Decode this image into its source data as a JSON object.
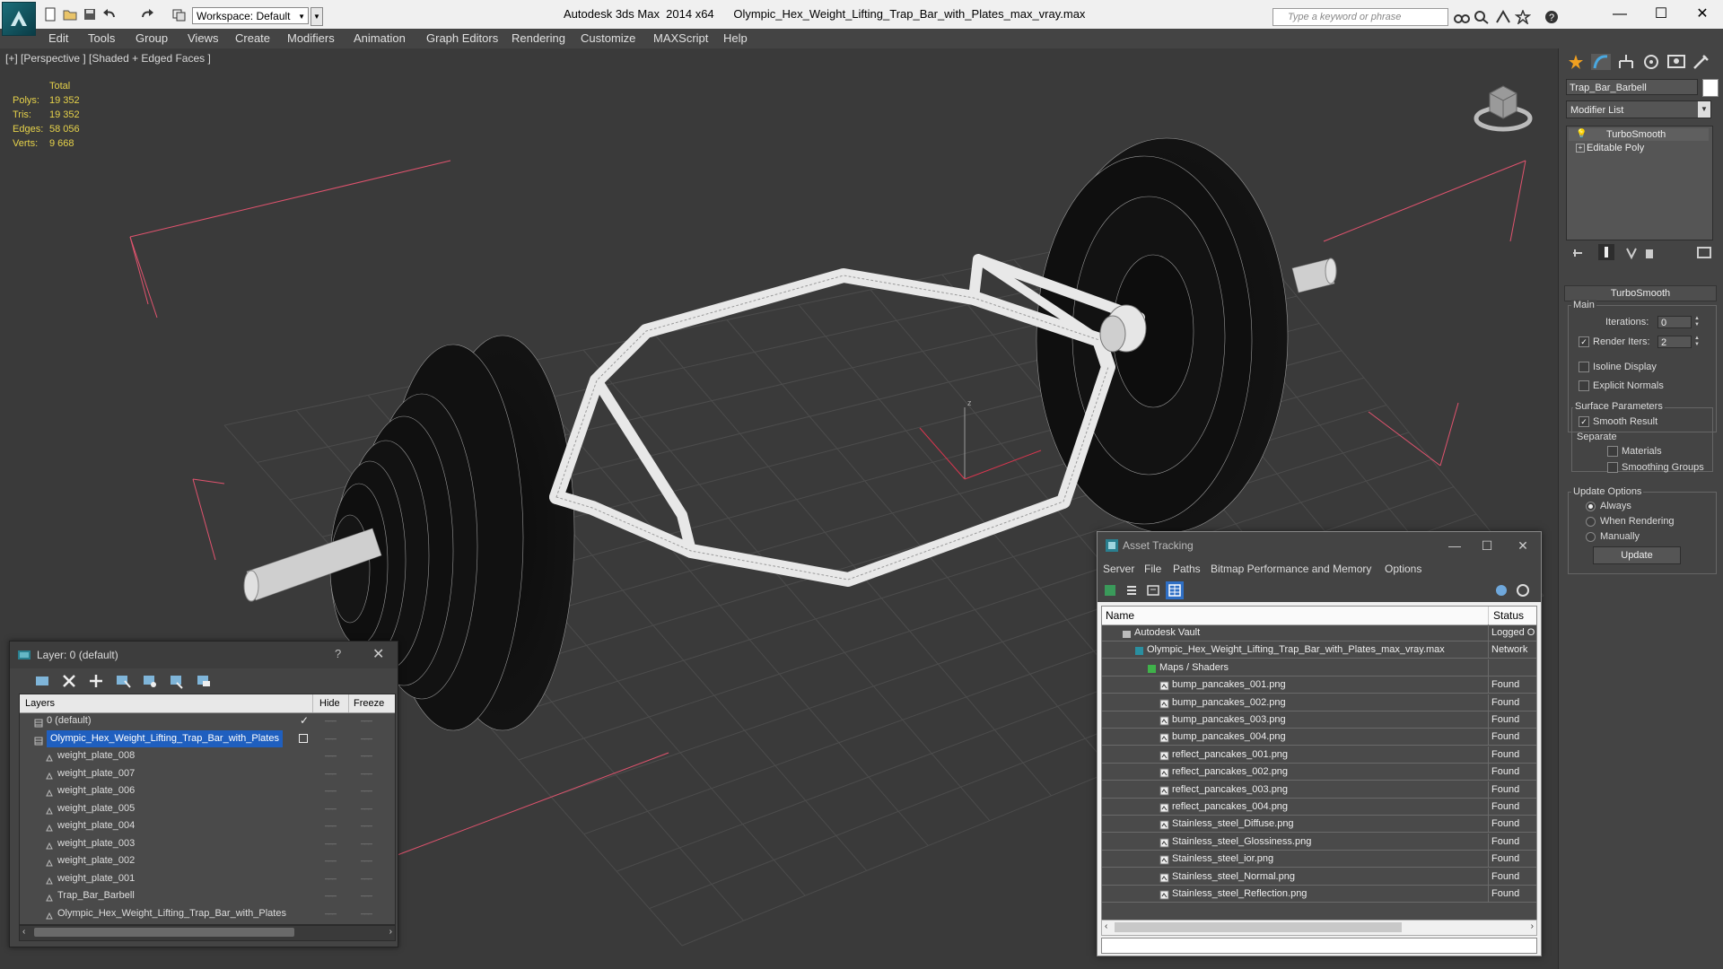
{
  "titlebar": {
    "workspace_label": "Workspace: Default",
    "app_title": "Autodesk 3ds Max  2014 x64      Olympic_Hex_Weight_Lifting_Trap_Bar_with_Plates_max_vray.max",
    "search_placeholder": "Type a keyword or phrase",
    "minimize": "—",
    "maximize": "☐",
    "close": "✕"
  },
  "menu": [
    "Edit",
    "Tools",
    "Group",
    "Views",
    "Create",
    "Modifiers",
    "Animation",
    "Graph Editors",
    "Rendering",
    "Customize",
    "MAXScript",
    "Help"
  ],
  "viewport": {
    "label": "[+] [Perspective ] [Shaded + Edged Faces ]",
    "stats_header": "Total",
    "stats": [
      {
        "key": "Polys:",
        "value": "19 352"
      },
      {
        "key": "Tris:",
        "value": "19 352"
      },
      {
        "key": "Edges:",
        "value": "58 056"
      },
      {
        "key": "Verts:",
        "value": "9 668"
      }
    ]
  },
  "command_panel": {
    "object_name": "Trap_Bar_Barbell",
    "modifier_list": "Modifier List",
    "stack": [
      "TurboSmooth",
      "Editable Poly"
    ],
    "rollout_title": "TurboSmooth",
    "main_label": "Main",
    "iterations_label": "Iterations:",
    "iterations_value": "0",
    "render_iters_label": "Render Iters:",
    "render_iters_value": "2",
    "render_iters_checked": true,
    "isoline_label": "Isoline Display",
    "explicit_label": "Explicit Normals",
    "surface_label": "Surface Parameters",
    "smooth_result_label": "Smooth Result",
    "separate_label": "Separate",
    "materials_label": "Materials",
    "smoothing_groups_label": "Smoothing Groups",
    "update_options_label": "Update Options",
    "always_label": "Always",
    "when_rendering_label": "When Rendering",
    "manually_label": "Manually",
    "update_button": "Update"
  },
  "layer_dialog": {
    "title": "Layer: 0 (default)",
    "help": "?",
    "close": "✕",
    "columns": {
      "layers": "Layers",
      "hide": "Hide",
      "freeze": "Freeze"
    },
    "rows": [
      {
        "name": "0 (default)",
        "level": 0,
        "selected": false
      },
      {
        "name": "Olympic_Hex_Weight_Lifting_Trap_Bar_with_Plates",
        "level": 0,
        "selected": true
      },
      {
        "name": "weight_plate_008",
        "level": 1,
        "selected": false
      },
      {
        "name": "weight_plate_007",
        "level": 1,
        "selected": false
      },
      {
        "name": "weight_plate_006",
        "level": 1,
        "selected": false
      },
      {
        "name": "weight_plate_005",
        "level": 1,
        "selected": false
      },
      {
        "name": "weight_plate_004",
        "level": 1,
        "selected": false
      },
      {
        "name": "weight_plate_003",
        "level": 1,
        "selected": false
      },
      {
        "name": "weight_plate_002",
        "level": 1,
        "selected": false
      },
      {
        "name": "weight_plate_001",
        "level": 1,
        "selected": false
      },
      {
        "name": "Trap_Bar_Barbell",
        "level": 1,
        "selected": false
      },
      {
        "name": "Olympic_Hex_Weight_Lifting_Trap_Bar_with_Plates",
        "level": 1,
        "selected": false
      }
    ],
    "hide_mark": "–––",
    "freeze_mark": "–––"
  },
  "asset_tracking": {
    "title": "Asset Tracking",
    "minimize": "—",
    "maximize": "☐",
    "close": "✕",
    "menu": [
      "Server",
      "File",
      "Paths",
      "Bitmap Performance and Memory",
      "Options"
    ],
    "columns": {
      "name": "Name",
      "status": "Status"
    },
    "rows": [
      {
        "name": "Autodesk Vault",
        "status": "Logged Out",
        "level": 0,
        "type": "vault"
      },
      {
        "name": "Olympic_Hex_Weight_Lifting_Trap_Bar_with_Plates_max_vray.max",
        "status": "Network",
        "level": 1,
        "type": "max"
      },
      {
        "name": "Maps / Shaders",
        "status": "",
        "level": 2,
        "type": "maps"
      },
      {
        "name": "bump_pancakes_001.png",
        "status": "Found",
        "level": 3,
        "type": "file"
      },
      {
        "name": "bump_pancakes_002.png",
        "status": "Found",
        "level": 3,
        "type": "file"
      },
      {
        "name": "bump_pancakes_003.png",
        "status": "Found",
        "level": 3,
        "type": "file"
      },
      {
        "name": "bump_pancakes_004.png",
        "status": "Found",
        "level": 3,
        "type": "file"
      },
      {
        "name": "reflect_pancakes_001.png",
        "status": "Found",
        "level": 3,
        "type": "file"
      },
      {
        "name": "reflect_pancakes_002.png",
        "status": "Found",
        "level": 3,
        "type": "file"
      },
      {
        "name": "reflect_pancakes_003.png",
        "status": "Found",
        "level": 3,
        "type": "file"
      },
      {
        "name": "reflect_pancakes_004.png",
        "status": "Found",
        "level": 3,
        "type": "file"
      },
      {
        "name": "Stainless_steel_Diffuse.png",
        "status": "Found",
        "level": 3,
        "type": "file"
      },
      {
        "name": "Stainless_steel_Glossiness.png",
        "status": "Found",
        "level": 3,
        "type": "file"
      },
      {
        "name": "Stainless_steel_ior.png",
        "status": "Found",
        "level": 3,
        "type": "file"
      },
      {
        "name": "Stainless_steel_Normal.png",
        "status": "Found",
        "level": 3,
        "type": "file"
      },
      {
        "name": "Stainless_steel_Reflection.png",
        "status": "Found",
        "level": 3,
        "type": "file"
      }
    ]
  }
}
